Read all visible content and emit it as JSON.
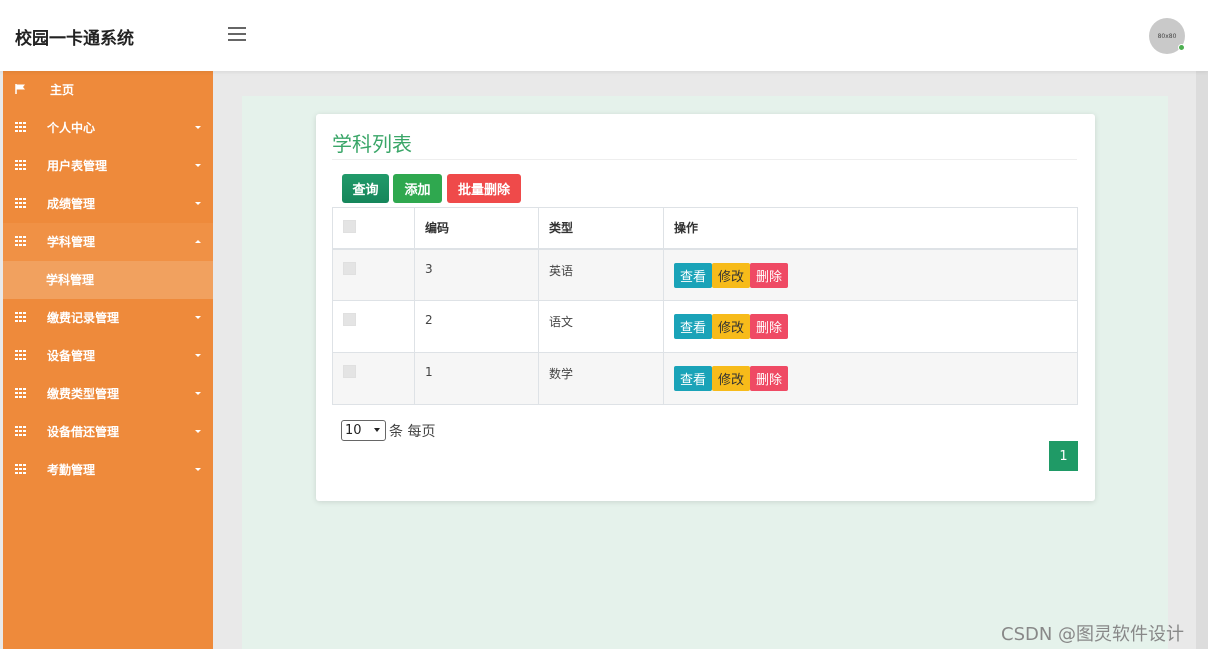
{
  "header": {
    "brand": "校园一卡通系统",
    "avatar_text": "80x80"
  },
  "sidebar": {
    "items": [
      {
        "label": "主页",
        "icon": "flag-icon"
      },
      {
        "label": "个人中心",
        "icon": "grid-icon"
      },
      {
        "label": "用户表管理",
        "icon": "grid-icon"
      },
      {
        "label": "成绩管理",
        "icon": "grid-icon"
      },
      {
        "label": "学科管理",
        "icon": "grid-icon",
        "sub": "学科管理"
      },
      {
        "label": "缴费记录管理",
        "icon": "grid-icon"
      },
      {
        "label": "设备管理",
        "icon": "grid-icon"
      },
      {
        "label": "缴费类型管理",
        "icon": "grid-icon"
      },
      {
        "label": "设备借还管理",
        "icon": "grid-icon"
      },
      {
        "label": "考勤管理",
        "icon": "grid-icon"
      }
    ]
  },
  "main": {
    "title": "学科列表",
    "buttons": {
      "query": "查询",
      "add": "添加",
      "batch_delete": "批量删除"
    },
    "table": {
      "columns": [
        "编码",
        "类型",
        "操作"
      ],
      "rows": [
        {
          "code": "3",
          "type": "英语"
        },
        {
          "code": "2",
          "type": "语文"
        },
        {
          "code": "1",
          "type": "数学"
        }
      ],
      "actions": {
        "view": "查看",
        "edit": "修改",
        "delete": "删除"
      }
    },
    "pager": {
      "page_size": "10",
      "size_suffix": "条 每页",
      "current_page": "1"
    }
  },
  "watermark": "CSDN @图灵软件设计",
  "colors": {
    "sidebar": "#ee8a3b",
    "accent_green": "#3aa668",
    "danger": "#ef4a64",
    "warning": "#f7bb1a",
    "info": "#1aa3b8"
  }
}
